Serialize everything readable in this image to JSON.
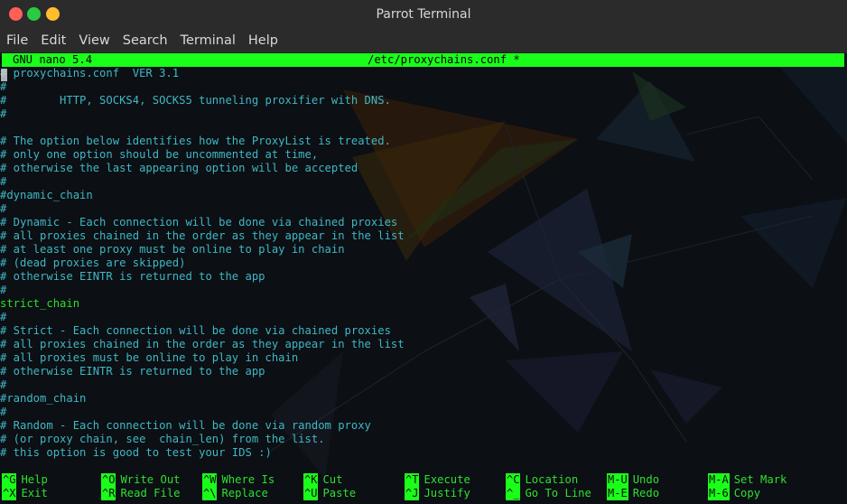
{
  "window": {
    "title": "Parrot Terminal",
    "colors": {
      "close": "#ff5f57",
      "minimize": "#ffbd2e",
      "maximize": "#2acb42"
    }
  },
  "menu": [
    "File",
    "Edit",
    "View",
    "Search",
    "Terminal",
    "Help"
  ],
  "nano": {
    "version": "GNU nano 5.4",
    "filename": "/etc/proxychains.conf *",
    "colors": {
      "bar": "#1aff1a",
      "comment": "#3fb8c4",
      "directive": "#28e028"
    }
  },
  "file_lines": [
    "# proxychains.conf  VER 3.1",
    "#",
    "#        HTTP, SOCKS4, SOCKS5 tunneling proxifier with DNS.",
    "#",
    "",
    "# The option below identifies how the ProxyList is treated.",
    "# only one option should be uncommented at time,",
    "# otherwise the last appearing option will be accepted",
    "#",
    "#dynamic_chain",
    "#",
    "# Dynamic - Each connection will be done via chained proxies",
    "# all proxies chained in the order as they appear in the list",
    "# at least one proxy must be online to play in chain",
    "# (dead proxies are skipped)",
    "# otherwise EINTR is returned to the app",
    "#",
    "strict_chain",
    "#",
    "# Strict - Each connection will be done via chained proxies",
    "# all proxies chained in the order as they appear in the list",
    "# all proxies must be online to play in chain",
    "# otherwise EINTR is returned to the app",
    "#",
    "#random_chain",
    "#",
    "# Random - Each connection will be done via random proxy",
    "# (or proxy chain, see  chain_len) from the list.",
    "# this option is good to test your IDS :)"
  ],
  "shortcuts": [
    [
      {
        "key": "^G",
        "label": "Help"
      },
      {
        "key": "^O",
        "label": "Write Out"
      },
      {
        "key": "^W",
        "label": "Where Is"
      },
      {
        "key": "^K",
        "label": "Cut"
      },
      {
        "key": "^T",
        "label": "Execute"
      },
      {
        "key": "^C",
        "label": "Location"
      },
      {
        "key": "M-U",
        "label": "Undo"
      },
      {
        "key": "M-A",
        "label": "Set Mark"
      }
    ],
    [
      {
        "key": "^X",
        "label": "Exit"
      },
      {
        "key": "^R",
        "label": "Read File"
      },
      {
        "key": "^\\",
        "label": "Replace"
      },
      {
        "key": "^U",
        "label": "Paste"
      },
      {
        "key": "^J",
        "label": "Justify"
      },
      {
        "key": "^_",
        "label": "Go To Line"
      },
      {
        "key": "M-E",
        "label": "Redo"
      },
      {
        "key": "M-6",
        "label": "Copy"
      }
    ]
  ]
}
